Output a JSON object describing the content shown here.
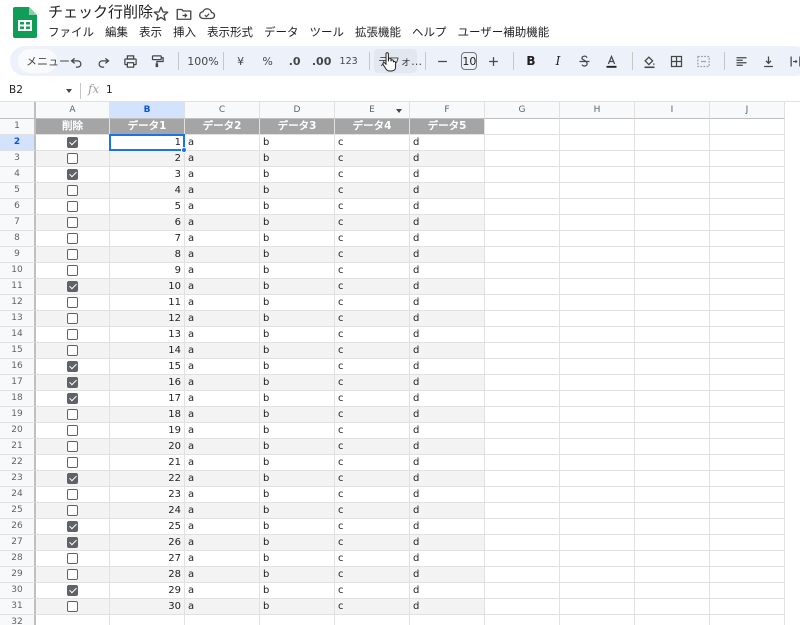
{
  "document": {
    "title": "チェック行削除"
  },
  "menu": [
    "ファイル",
    "編集",
    "表示",
    "挿入",
    "表示形式",
    "データ",
    "ツール",
    "拡張機能",
    "ヘルプ",
    "ユーザー補助機能"
  ],
  "toolbar": {
    "search_label": "メニュー",
    "zoom": "100%",
    "currency": "¥",
    "percent": "%",
    "decrease_decimal": ".0",
    "increase_decimal": ".00",
    "number_format": "123",
    "font": "デフォ…",
    "font_size": "10",
    "bold": "B",
    "italic": "I"
  },
  "formula_bar": {
    "cell_ref": "B2",
    "fx": "fx",
    "content": "1"
  },
  "columns": [
    "A",
    "B",
    "C",
    "D",
    "E",
    "F",
    "G",
    "H",
    "I",
    "J"
  ],
  "selected": {
    "column": "B",
    "row": 2
  },
  "table": {
    "headers": [
      "削除",
      "データ1",
      "データ2",
      "データ3",
      "データ4",
      "データ5"
    ],
    "rows": [
      {
        "checked": true,
        "n": "1",
        "c": "a",
        "d": "b",
        "e": "c",
        "f": "d"
      },
      {
        "checked": false,
        "n": "2",
        "c": "a",
        "d": "b",
        "e": "c",
        "f": "d"
      },
      {
        "checked": true,
        "n": "3",
        "c": "a",
        "d": "b",
        "e": "c",
        "f": "d"
      },
      {
        "checked": false,
        "n": "4",
        "c": "a",
        "d": "b",
        "e": "c",
        "f": "d"
      },
      {
        "checked": false,
        "n": "5",
        "c": "a",
        "d": "b",
        "e": "c",
        "f": "d"
      },
      {
        "checked": false,
        "n": "6",
        "c": "a",
        "d": "b",
        "e": "c",
        "f": "d"
      },
      {
        "checked": false,
        "n": "7",
        "c": "a",
        "d": "b",
        "e": "c",
        "f": "d"
      },
      {
        "checked": false,
        "n": "8",
        "c": "a",
        "d": "b",
        "e": "c",
        "f": "d"
      },
      {
        "checked": false,
        "n": "9",
        "c": "a",
        "d": "b",
        "e": "c",
        "f": "d"
      },
      {
        "checked": true,
        "n": "10",
        "c": "a",
        "d": "b",
        "e": "c",
        "f": "d"
      },
      {
        "checked": false,
        "n": "11",
        "c": "a",
        "d": "b",
        "e": "c",
        "f": "d"
      },
      {
        "checked": false,
        "n": "12",
        "c": "a",
        "d": "b",
        "e": "c",
        "f": "d"
      },
      {
        "checked": false,
        "n": "13",
        "c": "a",
        "d": "b",
        "e": "c",
        "f": "d"
      },
      {
        "checked": false,
        "n": "14",
        "c": "a",
        "d": "b",
        "e": "c",
        "f": "d"
      },
      {
        "checked": true,
        "n": "15",
        "c": "a",
        "d": "b",
        "e": "c",
        "f": "d"
      },
      {
        "checked": true,
        "n": "16",
        "c": "a",
        "d": "b",
        "e": "c",
        "f": "d"
      },
      {
        "checked": true,
        "n": "17",
        "c": "a",
        "d": "b",
        "e": "c",
        "f": "d"
      },
      {
        "checked": false,
        "n": "18",
        "c": "a",
        "d": "b",
        "e": "c",
        "f": "d"
      },
      {
        "checked": false,
        "n": "19",
        "c": "a",
        "d": "b",
        "e": "c",
        "f": "d"
      },
      {
        "checked": false,
        "n": "20",
        "c": "a",
        "d": "b",
        "e": "c",
        "f": "d"
      },
      {
        "checked": false,
        "n": "21",
        "c": "a",
        "d": "b",
        "e": "c",
        "f": "d"
      },
      {
        "checked": true,
        "n": "22",
        "c": "a",
        "d": "b",
        "e": "c",
        "f": "d"
      },
      {
        "checked": false,
        "n": "23",
        "c": "a",
        "d": "b",
        "e": "c",
        "f": "d"
      },
      {
        "checked": false,
        "n": "24",
        "c": "a",
        "d": "b",
        "e": "c",
        "f": "d"
      },
      {
        "checked": true,
        "n": "25",
        "c": "a",
        "d": "b",
        "e": "c",
        "f": "d"
      },
      {
        "checked": true,
        "n": "26",
        "c": "a",
        "d": "b",
        "e": "c",
        "f": "d"
      },
      {
        "checked": false,
        "n": "27",
        "c": "a",
        "d": "b",
        "e": "c",
        "f": "d"
      },
      {
        "checked": false,
        "n": "28",
        "c": "a",
        "d": "b",
        "e": "c",
        "f": "d"
      },
      {
        "checked": true,
        "n": "29",
        "c": "a",
        "d": "b",
        "e": "c",
        "f": "d"
      },
      {
        "checked": false,
        "n": "30",
        "c": "a",
        "d": "b",
        "e": "c",
        "f": "d"
      }
    ],
    "empty_rows": 1
  },
  "colors": {
    "brand_green": "#0f9d58",
    "header_gray": "#a5a5a5",
    "band_gray": "#f3f3f3",
    "selection_blue": "#1a73e8"
  }
}
